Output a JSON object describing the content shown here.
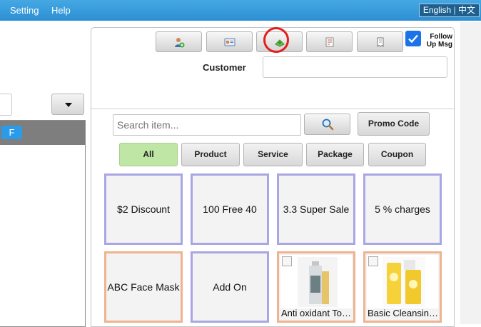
{
  "topbar": {
    "menu": [
      "Setting",
      "Help"
    ],
    "lang_english": "English",
    "lang_chinese": "中文"
  },
  "left": {
    "badge": "F"
  },
  "toolbar": {
    "icons": [
      "add-customer-icon",
      "customer-card-icon",
      "cash-drawer-icon",
      "calculator-list-icon",
      "receipt-icon"
    ],
    "follow_up_label": "Follow Up Msg",
    "follow_up_checked": true
  },
  "customer": {
    "label": "Customer",
    "value": ""
  },
  "search": {
    "placeholder": "Search item...",
    "promo_label": "Promo Code"
  },
  "tabs": [
    "All",
    "Product",
    "Service",
    "Package",
    "Coupon"
  ],
  "active_tab": "All",
  "items": [
    {
      "label": "$2 Discount"
    },
    {
      "label": "100 Free 40"
    },
    {
      "label": "3.3 Super Sale"
    },
    {
      "label": "5 % charges"
    },
    {
      "label": "ABC Face Mask"
    },
    {
      "label": "Add On"
    },
    {
      "label": "Anti oxidant Toner"
    },
    {
      "label": "Basic Cleansing Lotion"
    }
  ],
  "colors": {
    "topbar": "#2d8fd3",
    "active_tab": "#bfe6a4",
    "tile_border_purple": "#a9a6e4",
    "tile_border_orange": "#f0b290",
    "highlight_circle": "#e41e1e"
  }
}
